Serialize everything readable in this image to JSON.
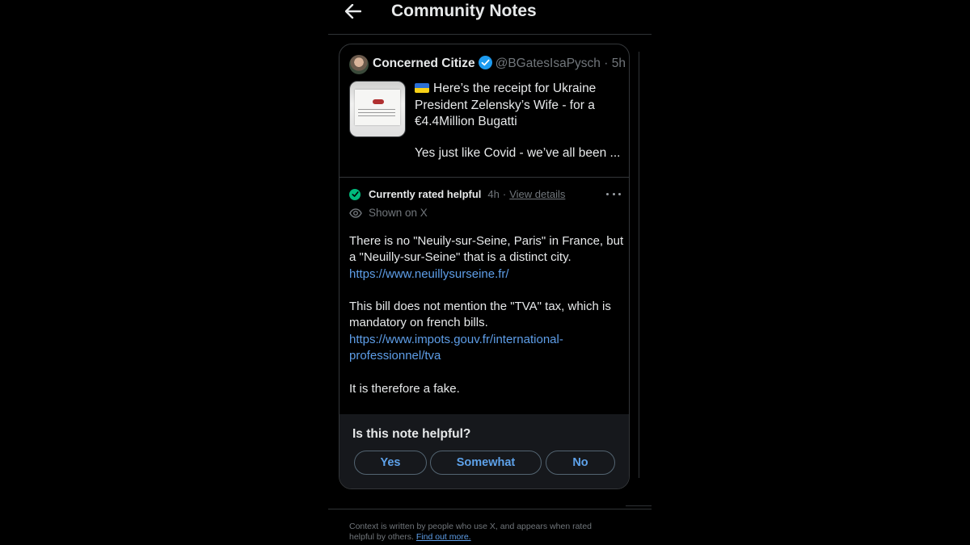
{
  "header": {
    "title": "Community Notes"
  },
  "tweet": {
    "author_name": "Concerned Citize",
    "handle": "@BGatesIsaPysch",
    "separator": "·",
    "time": "5h",
    "text": "Here’s the receipt for Ukraine President Zelensky’s Wife - for a €4.4Million Bugatti",
    "text_cont": "Yes just like Covid - we’ve all been ..."
  },
  "note": {
    "status": "Currently rated helpful",
    "time": "4h",
    "separator": "·",
    "view_details": "View details",
    "shown_on": "Shown on X",
    "para1": "There is no \"Neuily-sur-Seine, Paris\" in France, but a \"Neuilly-sur-Seine\" that is a distinct city.",
    "link1": "https://www.neuillysurseine.fr/",
    "para2": "This bill does not mention the \"TVA\" tax, which is mandatory on french bills.",
    "link2": "https://www.impots.gouv.fr/international-professionnel/tva",
    "para3": "It is therefore a fake."
  },
  "rating": {
    "question": "Is this note helpful?",
    "yes": "Yes",
    "somewhat": "Somewhat",
    "no": "No"
  },
  "footer": {
    "text": "Context is written by people who use X, and appears when rated helpful by others.",
    "link": "Find out more."
  },
  "colors": {
    "background": "#000000",
    "accent_link": "#5e9ee8",
    "helpful_green": "#00ba7c",
    "verified_blue": "#1d9bf0",
    "panel_bg": "#16181c"
  },
  "icons": [
    "back-arrow-icon",
    "verified-badge-icon",
    "checkmark-icon",
    "more-dots-icon",
    "eye-icon"
  ]
}
